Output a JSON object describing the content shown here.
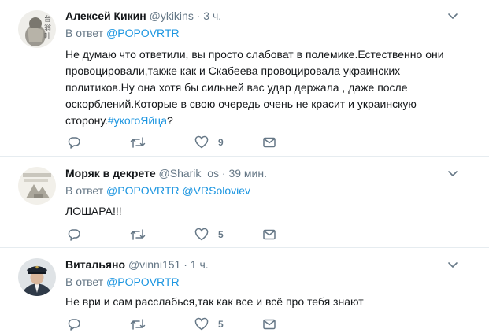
{
  "tweets": [
    {
      "name": "Алексей Кикин",
      "handle": "@ykikins",
      "sep": "·",
      "time": "3 ч.",
      "reply_prefix": "В ответ",
      "reply_to": [
        "@POPOVRTR"
      ],
      "text_plain": "Не думаю что ответили, вы просто слабоват в полемике.Естественно они провоцировали,также как и Скабеева провоцировала украинских политиков.Ну она хотя бы сильней вас удар держала , даже после оскорблений.Которые в свою очередь очень не красит и украинскую сторону.",
      "hashtag": "#укогоЯйца",
      "text_end": "?",
      "likes": "9"
    },
    {
      "name": "Моряк в декрете",
      "handle": "@Sharik_os",
      "sep": "·",
      "time": "39 мин.",
      "reply_prefix": "В ответ",
      "reply_to": [
        "@POPOVRTR",
        "@VRSoloviev"
      ],
      "text_plain": "ЛОШАРА!!!",
      "likes": "5"
    },
    {
      "name": "Витальяно",
      "handle": "@vinni151",
      "sep": "·",
      "time": "1 ч.",
      "reply_prefix": "В ответ",
      "reply_to": [
        "@POPOVRTR"
      ],
      "text_plain": "Не ври и сам расслабься,так как все и всё про тебя знают",
      "likes": "5"
    }
  ],
  "icons": {
    "reply": "reply-icon",
    "retweet": "retweet-icon",
    "like": "heart-icon",
    "dm": "direct-message-icon",
    "more": "chevron-down-icon"
  },
  "colors": {
    "link": "#1b95e0",
    "muted": "#657786",
    "text": "#14171a",
    "divider": "#e6ecf0"
  }
}
